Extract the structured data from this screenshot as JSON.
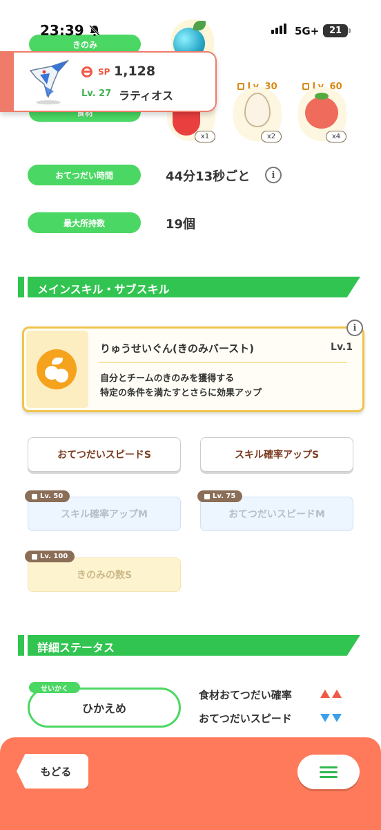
{
  "status_bar": {
    "time": "23:39",
    "network": "5G+",
    "battery": "21"
  },
  "top_labels": {
    "berry": "きのみ",
    "ingredient": "食材"
  },
  "ingredients": [
    {
      "name": "pepper",
      "lock": "",
      "count": "x1"
    },
    {
      "name": "egg",
      "lock": "Lv. 30",
      "count": "x2"
    },
    {
      "name": "tomato",
      "lock": "Lv. 60",
      "count": "x4"
    }
  ],
  "pokemon": {
    "sp_label": "SP",
    "sp_value": "1,128",
    "level": "Lv. 27",
    "name": "ラティオス"
  },
  "info": {
    "help_time_label": "おてつだい時間",
    "help_time_value": "44分13秒ごと",
    "max_carry_label": "最大所持数",
    "max_carry_value": "19個"
  },
  "sections": {
    "skills": "メインスキル・サブスキル",
    "details": "詳細ステータス"
  },
  "main_skill": {
    "name": "りゅうせいぐん(きのみバースト)",
    "level": "Lv.1",
    "desc_line1": "自分とチームのきのみを獲得する",
    "desc_line2": "特定の条件を満たすとさらに効果アップ"
  },
  "sub_skills": [
    {
      "label": "おてつだいスピードS",
      "lock": "",
      "state": "active"
    },
    {
      "label": "スキル確率アップS",
      "lock": "",
      "state": "active"
    },
    {
      "label": "スキル確率アップM",
      "lock": "Lv. 50",
      "state": "locked"
    },
    {
      "label": "おてつだいスピードM",
      "lock": "Lv. 75",
      "state": "locked"
    },
    {
      "label": "きのみの数S",
      "lock": "Lv. 100",
      "state": "locked"
    }
  ],
  "nature": {
    "tag": "せいかく",
    "value": "ひかえめ",
    "up_effect": "食材おてつだい確率",
    "down_effect": "おてつだいスピード"
  },
  "nav": {
    "back": "もどる"
  },
  "colors": {
    "green": "#4bd763",
    "section_green": "#31c451",
    "coral": "#ff7a5a",
    "skill_gold": "#f0c44a"
  }
}
